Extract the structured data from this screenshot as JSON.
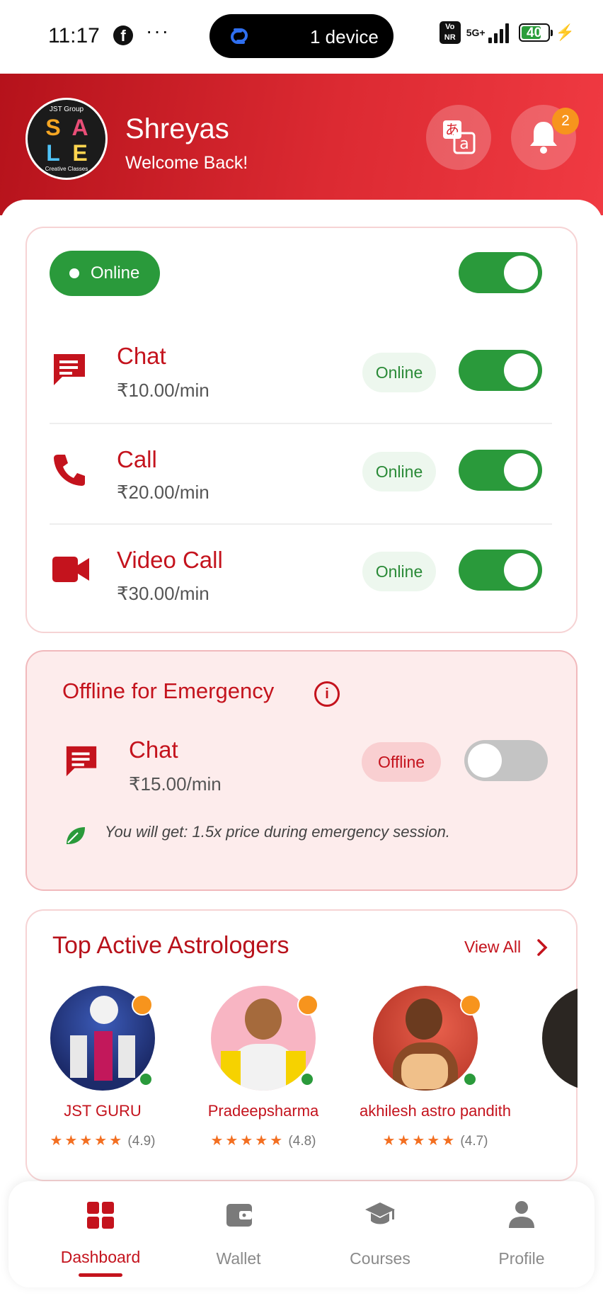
{
  "status_bar": {
    "time": "11:17",
    "app_icon": "facebook-icon",
    "dots": "···",
    "island_text": "1 device",
    "network": "5G+",
    "volte": "Vo NR",
    "battery": "40"
  },
  "header": {
    "avatar_text_top": "JST Group",
    "avatar_letters": [
      "S",
      "A",
      "L",
      "E"
    ],
    "avatar_text_bottom": "Creative Classes",
    "name": "Shreyas",
    "subtitle": "Welcome Back!",
    "notification_count": "2",
    "colors": {
      "start": "#b5121b",
      "end": "#f03a42"
    }
  },
  "availability": {
    "master_status": "Online",
    "services": [
      {
        "title": "Chat",
        "price": "₹10.00/min",
        "status": "Online",
        "icon": "chat-icon"
      },
      {
        "title": "Call",
        "price": "₹20.00/min",
        "status": "Online",
        "icon": "phone-icon"
      },
      {
        "title": "Video Call",
        "price": "₹30.00/min",
        "status": "Online",
        "icon": "video-icon"
      }
    ]
  },
  "emergency": {
    "title": "Offline for Emergency",
    "info": "i",
    "service": {
      "title": "Chat",
      "price": "₹15.00/min",
      "status": "Offline"
    },
    "note": "You will get: 1.5x price during emergency session."
  },
  "astrologers": {
    "title": "Top Active Astrologers",
    "view_all": "View All",
    "items": [
      {
        "name": "JST GURU",
        "rating": "(4.9)",
        "stars": "★★★★★"
      },
      {
        "name": "Pradeepsharma",
        "rating": "(4.8)",
        "stars": "★★★★★"
      },
      {
        "name": "akhilesh astro pandith",
        "rating": "(4.7)",
        "stars": "★★★★★"
      }
    ]
  },
  "bottom_nav": {
    "items": [
      {
        "label": "Dashboard",
        "icon": "dashboard-icon",
        "active": true
      },
      {
        "label": "Wallet",
        "icon": "wallet-icon",
        "active": false
      },
      {
        "label": "Courses",
        "icon": "graduation-cap-icon",
        "active": false
      },
      {
        "label": "Profile",
        "icon": "person-icon",
        "active": false
      }
    ]
  },
  "colors": {
    "brand_red": "#c4131d",
    "online_green": "#2a9a3b",
    "accent_orange": "#f7941d"
  }
}
